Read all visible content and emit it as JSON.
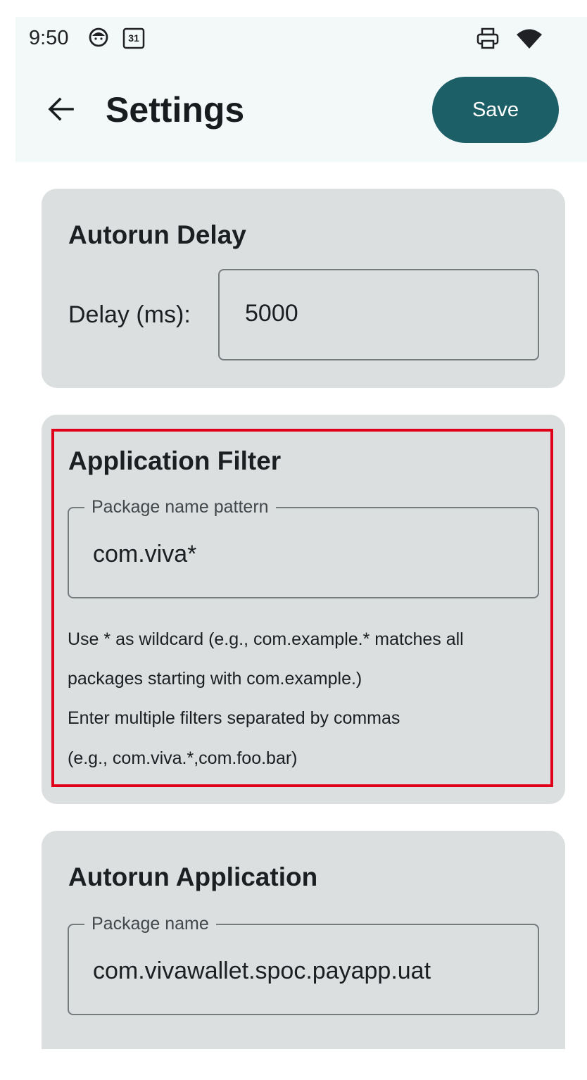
{
  "status_bar": {
    "time": "9:50",
    "left_icons": [
      "face-icon",
      "calendar-icon"
    ],
    "calendar_day": "31",
    "right_icons": [
      "print-icon",
      "wifi-icon"
    ]
  },
  "app_bar": {
    "back_icon": "arrow-back-icon",
    "title": "Settings",
    "save_label": "Save"
  },
  "autorun_delay": {
    "title": "Autorun Delay",
    "field_label": "Delay (ms):",
    "value": "5000"
  },
  "application_filter": {
    "title": "Application Filter",
    "field_label": "Package name pattern",
    "value": "com.viva*",
    "helper_lines": [
      "Use * as wildcard (e.g., com.example.* matches all",
      "packages starting with com.example.)",
      "Enter multiple filters separated by commas",
      "(e.g., com.viva.*,com.foo.bar)"
    ]
  },
  "autorun_application": {
    "title": "Autorun Application",
    "field_label": "Package name",
    "value": "com.vivawallet.spoc.payapp.uat"
  },
  "colors": {
    "accent": "#1d5f66",
    "card_bg": "#dcdfe0",
    "highlight": "#e0001a",
    "appbar_bg": "#f3f8f8"
  }
}
